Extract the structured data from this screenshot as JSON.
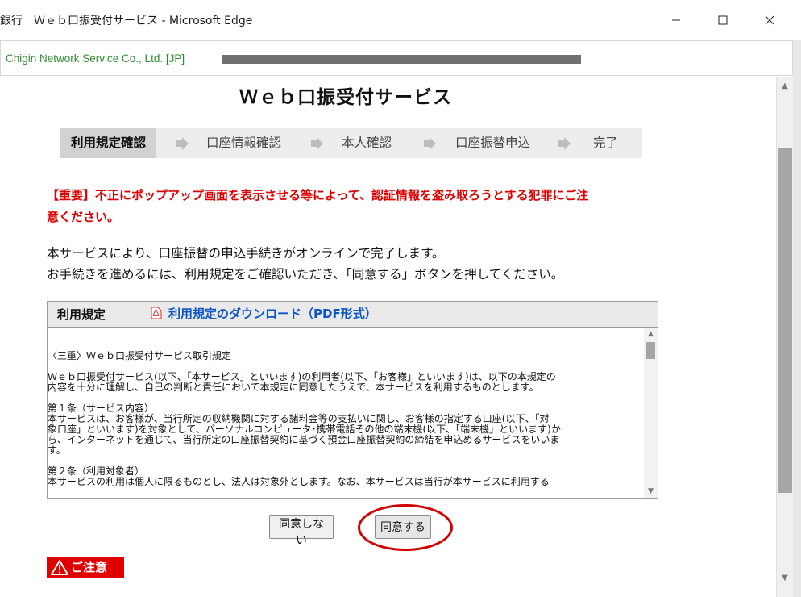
{
  "window": {
    "title": "銀行　Ｗｅｂ口振受付サービス - Microsoft Edge",
    "minimize_icon": "minimize-icon",
    "maximize_icon": "maximize-icon",
    "close_icon": "close-icon"
  },
  "address_bar": {
    "site_identity": "Chigin Network Service Co., Ltd. [JP]"
  },
  "page": {
    "title": "Ｗｅｂ口振受付サービス",
    "steps": [
      "利用規定確認",
      "口座情報確認",
      "本人確認",
      "口座振替申込",
      "完了"
    ],
    "active_step": "利用規定確認",
    "warning_line1": "【重要】不正にポップアップ画面を表示させる等によって、認証情報を盗み取ろうとする犯罪にご注",
    "warning_line2": "意ください。",
    "intro_line1": "本サービスにより、口座振替の申込手続きがオンラインで完了します。",
    "intro_line2": "お手続きを進めるには、利用規定をご確認いただき、「同意する」ボタンを押してください。",
    "terms": {
      "header_label": "利用規定",
      "download_link": "利用規定のダウンロード（PDF形式）",
      "para1": "〈三重〉Ｗｅｂ口振受付サービス取引規定",
      "para2": "Ｗｅｂ口振受付サービス(以下、「本サービス」といいます)の利用者(以下、「お客様」といいます)は、以下の本規定の\n内容を十分に理解し、自己の判断と責任において本規定に同意したうえで、本サービスを利用するものとします。",
      "para3": "第１条（サービス内容）\n本サービスは、お客様が、当行所定の収納機関に対する諸料金等の支払いに関し、お客様の指定する口座(以下、「対\n象口座」といいます)を対象として、パーソナルコンピュータ･携帯電話その他の端末機(以下、「端末機」といいます)か\nら、インターネットを通じて、当行所定の口座振替契約に基づく預金口座振替契約の締結を申込めるサービスをいいま\nす。",
      "para4": "第２条（利用対象者）\n本サービスの利用は個人に限るものとし、法人は対象外とします。なお、本サービスは当行が本サービスに利用する"
    },
    "buttons": {
      "disagree": "同意しない",
      "agree": "同意する"
    },
    "notice_label": "ご注意"
  },
  "colors": {
    "warning_red": "#dd0000",
    "link_blue": "#0b55c4",
    "site_green": "#2e8b2e",
    "highlight_circle": "#d00000"
  }
}
